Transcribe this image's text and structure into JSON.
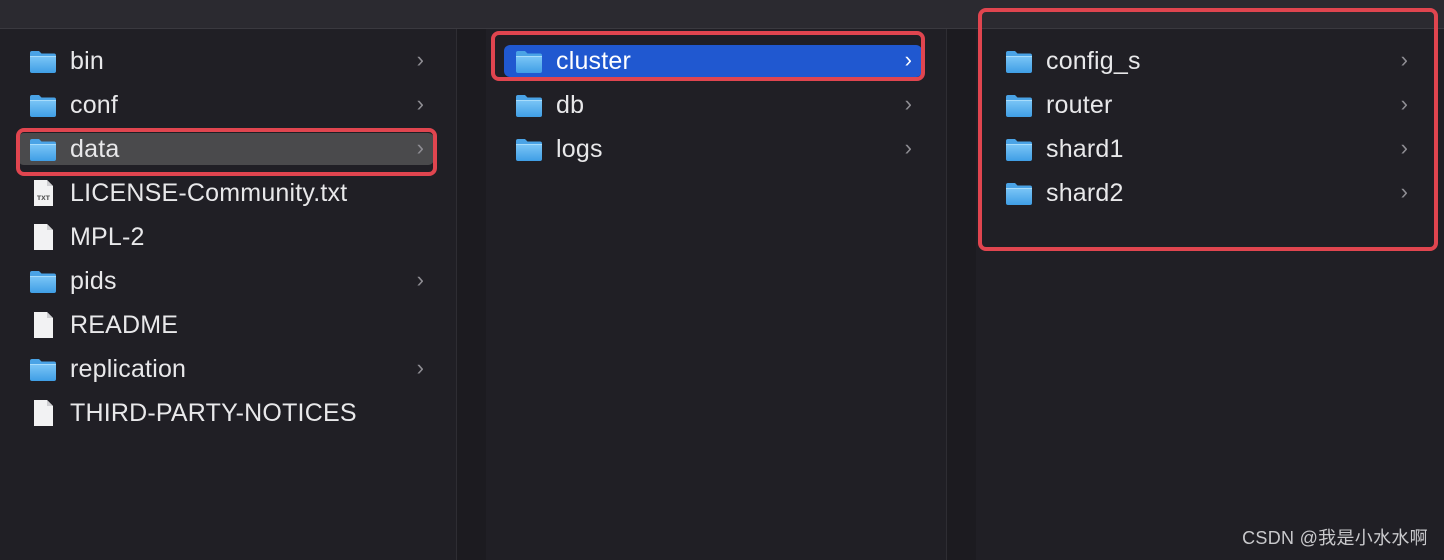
{
  "columns": [
    {
      "items": [
        {
          "name": "bin",
          "kind": "folder",
          "chevron": "›"
        },
        {
          "name": "conf",
          "kind": "folder",
          "chevron": "›"
        },
        {
          "name": "data",
          "kind": "folder",
          "chevron": "›",
          "state": "selected-inactive"
        },
        {
          "name": "LICENSE-Community.txt",
          "kind": "text-file",
          "file_badge": "TXT"
        },
        {
          "name": "MPL-2",
          "kind": "file"
        },
        {
          "name": "pids",
          "kind": "folder",
          "chevron": "›"
        },
        {
          "name": "README",
          "kind": "file"
        },
        {
          "name": "replication",
          "kind": "folder",
          "chevron": "›"
        },
        {
          "name": "THIRD-PARTY-NOTICES",
          "kind": "file"
        }
      ]
    },
    {
      "items": [
        {
          "name": "cluster",
          "kind": "folder",
          "chevron": "›",
          "state": "selected-active"
        },
        {
          "name": "db",
          "kind": "folder",
          "chevron": "›"
        },
        {
          "name": "logs",
          "kind": "folder",
          "chevron": "›"
        }
      ]
    },
    {
      "items": [
        {
          "name": "config_s",
          "kind": "folder",
          "chevron": "›"
        },
        {
          "name": "router",
          "kind": "folder",
          "chevron": "›"
        },
        {
          "name": "shard1",
          "kind": "folder",
          "chevron": "›"
        },
        {
          "name": "shard2",
          "kind": "folder",
          "chevron": "›"
        }
      ]
    }
  ],
  "watermark": "CSDN @我是小水水啊",
  "colors": {
    "background": "#201f25",
    "selection_active": "#2058d0",
    "selection_inactive": "#4a4a4c",
    "highlight_box": "#e0454f",
    "folder_blue": "#5ab4f0"
  }
}
